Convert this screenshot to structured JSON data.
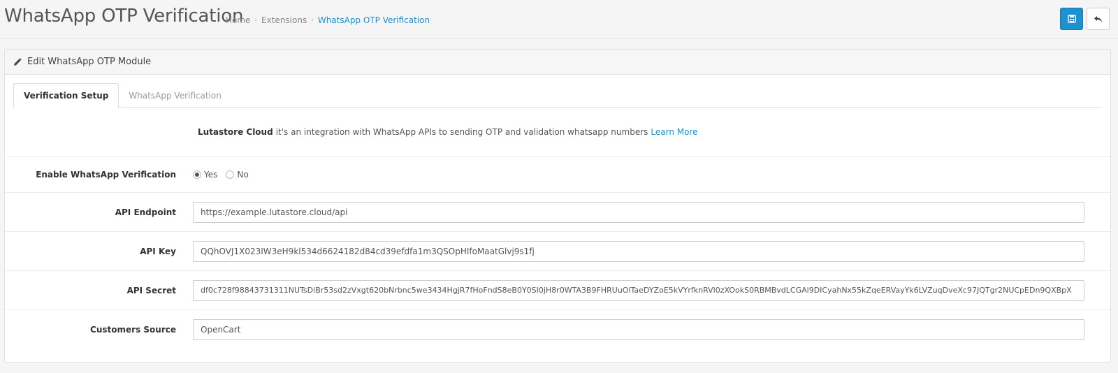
{
  "header": {
    "title": "WhatsApp OTP Verification",
    "breadcrumb": [
      "Home",
      "Extensions",
      "WhatsApp OTP Verification"
    ],
    "save_icon": "save-icon",
    "back_icon": "reply-icon"
  },
  "panel": {
    "heading": "Edit WhatsApp OTP Module",
    "heading_icon": "pencil-icon"
  },
  "tabs": [
    {
      "label": "Verification Setup",
      "active": true
    },
    {
      "label": "WhatsApp Verification",
      "active": false
    }
  ],
  "intro": {
    "brand": "Lutastore Cloud",
    "text": "it's an integration with WhatsApp APIs to sending OTP and validation whatsapp numbers",
    "link": "Learn More"
  },
  "form": {
    "enable": {
      "label": "Enable WhatsApp Verification",
      "options": [
        "Yes",
        "No"
      ],
      "selected": "Yes"
    },
    "endpoint": {
      "label": "API Endpoint",
      "value": "https://example.lutastore.cloud/api"
    },
    "key": {
      "label": "API Key",
      "value": "QQhOVJ1X023IW3eH9kl534d6624182d84cd39efdfa1m3QSOpHIfoMaatGlvj9s1fj"
    },
    "secret": {
      "label": "API Secret",
      "value": "df0c728f98843731311NUTsDiBr53sd2zVxgt620bNrbnc5we3434HgjR7fHoFndS8eB0Y0SI0jH8r0WTA3B9FHRUuOlTaeDYZoE5kVYrfknRVl0zXOokS0RBMBvdLCGAl9DICyahNx55kZqeERVayYk6LVZuqDveXc97JQTgr2NUCpEDn9QXBpX"
    },
    "source": {
      "label": "Customers Source",
      "value": "OpenCart"
    }
  },
  "colors": {
    "accent": "#1e91cf"
  }
}
